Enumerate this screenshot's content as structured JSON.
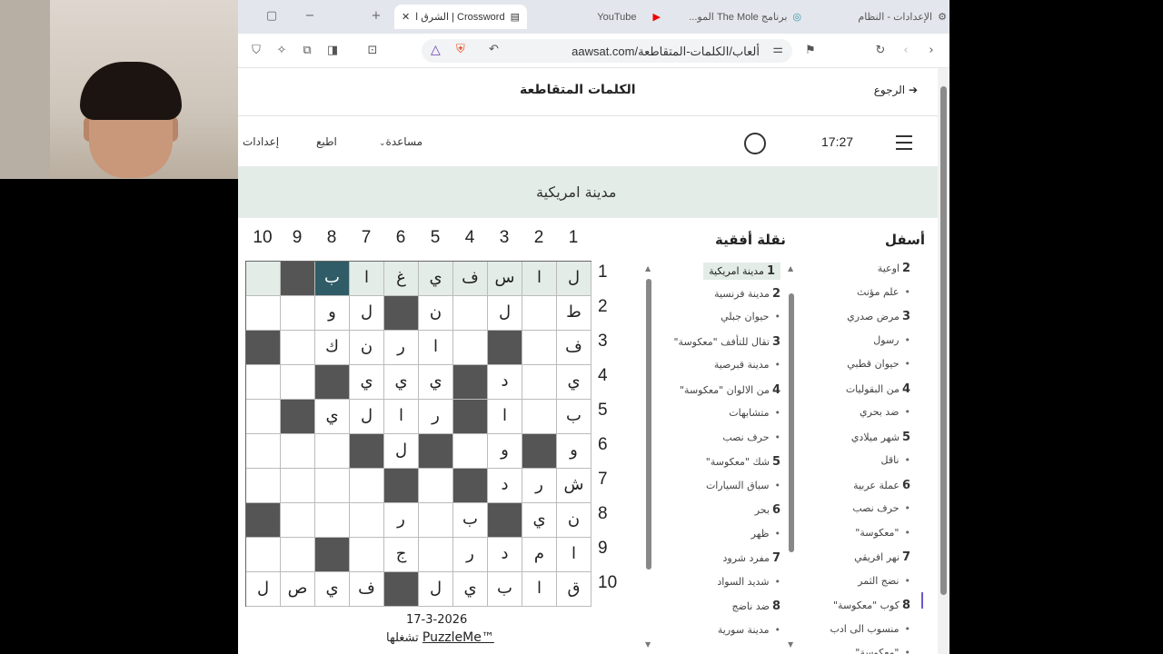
{
  "webcam": {
    "label": ""
  },
  "browser": {
    "tabs": [
      {
        "label": "الإعدادات - النظام",
        "icon": "gear-icon"
      },
      {
        "label": "برنامج The Mole المو...",
        "icon": "globe-icon"
      },
      {
        "label": "YouTube",
        "icon": "youtube-icon"
      },
      {
        "label": "Crossword | الشرق الأوسط",
        "icon": "newspaper-icon"
      }
    ],
    "url": "aawsat.com/ألعاب/الكلمات-المتقاطعة"
  },
  "page": {
    "title": "الكلمات المتقاطعة",
    "back_label": "الرجوع",
    "menu": {
      "settings": "إعدادات",
      "print": "اطبع",
      "help": "مساعدة"
    },
    "timer": "17:27",
    "current_clue": "مدينة امريكية",
    "date": "17-3-2026",
    "powered_prefix": "تشغلها",
    "brand": "PuzzleMe™"
  },
  "grid": {
    "size": 10,
    "col_numbers": [
      "10",
      "9",
      "8",
      "7",
      "6",
      "5",
      "4",
      "3",
      "2",
      "1"
    ],
    "row_numbers": [
      "1",
      "2",
      "3",
      "4",
      "5",
      "6",
      "7",
      "8",
      "9",
      "10"
    ],
    "rows": [
      [
        "",
        "#",
        "ب",
        "ا",
        "غ",
        "ي",
        "ف",
        "س",
        "ا",
        "ل"
      ],
      [
        "",
        "",
        "و",
        "ل",
        "#",
        "ن",
        "",
        "ل",
        "",
        "ط"
      ],
      [
        "#",
        "",
        "ك",
        "ن",
        "ر",
        "ا",
        "",
        "#",
        "",
        "ف"
      ],
      [
        "",
        "",
        "#",
        "ي",
        "ي",
        "ي",
        "#",
        "د",
        "",
        "ي"
      ],
      [
        "",
        "#",
        "ي",
        "ل",
        "ا",
        "ر",
        "#",
        "ا",
        "",
        "ب"
      ],
      [
        "",
        "",
        "",
        "#",
        "ل",
        "#",
        "",
        "و",
        "#",
        "و"
      ],
      [
        "",
        "",
        "",
        "",
        "#",
        "",
        "#",
        "د",
        "ر",
        "ش"
      ],
      [
        "#",
        "",
        "",
        "",
        "ر",
        "",
        "ب",
        "#",
        "ي",
        "ن"
      ],
      [
        "",
        "",
        "#",
        "",
        "ج",
        "",
        "ر",
        "د",
        "م",
        "ا"
      ],
      [
        "ل",
        "ص",
        "ي",
        "ف",
        "#",
        "ل",
        "ي",
        "ب",
        "ا",
        "ق"
      ]
    ]
  },
  "across": {
    "heading": "نقلة أفقية",
    "items": [
      {
        "num": "1",
        "text": "مدينة امريكية"
      },
      {
        "num": "2",
        "text": "مدينة فرنسية"
      },
      {
        "num": "",
        "text": "حيوان جبلي"
      },
      {
        "num": "3",
        "text": "تقال للتأفف \"معكوسة\""
      },
      {
        "num": "",
        "text": "مدينة قبرصية"
      },
      {
        "num": "4",
        "text": "من الالوان \"معكوسة\""
      },
      {
        "num": "",
        "text": "متشابهات"
      },
      {
        "num": "",
        "text": "حرف نصب"
      },
      {
        "num": "5",
        "text": "شك \"معكوسة\""
      },
      {
        "num": "",
        "text": "سباق السيارات"
      },
      {
        "num": "6",
        "text": "بحر"
      },
      {
        "num": "",
        "text": "ظهر"
      },
      {
        "num": "7",
        "text": "مفرد شرود"
      },
      {
        "num": "",
        "text": "شديد السواد"
      },
      {
        "num": "8",
        "text": "ضد ناضج"
      },
      {
        "num": "",
        "text": "مدينة سورية"
      }
    ]
  },
  "down": {
    "heading": "أسفل",
    "items": [
      {
        "num": "2",
        "text": "اوعية"
      },
      {
        "num": "",
        "text": "علم مؤنث"
      },
      {
        "num": "3",
        "text": "مرض صدري"
      },
      {
        "num": "",
        "text": "رسول"
      },
      {
        "num": "",
        "text": "حيوان قطبي"
      },
      {
        "num": "4",
        "text": "من البقوليات"
      },
      {
        "num": "",
        "text": "ضد بحري"
      },
      {
        "num": "5",
        "text": "شهر ميلادي"
      },
      {
        "num": "",
        "text": "ناقل"
      },
      {
        "num": "6",
        "text": "عملة عربية"
      },
      {
        "num": "",
        "text": "حرف نصب"
      },
      {
        "num": "",
        "text": "\"معكوسة\""
      },
      {
        "num": "7",
        "text": "نهر افريقي"
      },
      {
        "num": "",
        "text": "نضج الثمر"
      },
      {
        "num": "8",
        "text": "كوب \"معكوسة\""
      },
      {
        "num": "",
        "text": "منسوب الى ادب"
      },
      {
        "num": "",
        "text": "\"معكوسة\""
      }
    ]
  }
}
